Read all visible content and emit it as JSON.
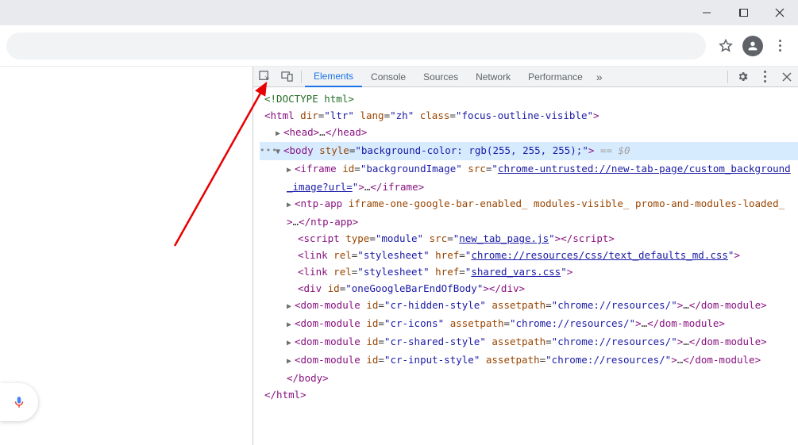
{
  "tabs": {
    "elements": "Elements",
    "console": "Console",
    "sources": "Sources",
    "network": "Network",
    "performance": "Performance"
  },
  "dom": {
    "doctype": "<!DOCTYPE html>",
    "html_open": {
      "dir": "ltr",
      "lang": "zh",
      "class": "focus-outline-visible"
    },
    "head": "head",
    "body_style": "background-color: rgb(255, 255, 255);",
    "eq_sel": " == $0",
    "iframe": {
      "id": "backgroundImage",
      "src": "chrome-untrusted://new-tab-page/custom_background_image?url="
    },
    "ntp_app_attrs": "iframe-one-google-bar-enabled_ modules-visible_ promo-and-modules-loaded_",
    "script": {
      "type": "module",
      "src": "new_tab_page.js"
    },
    "link1": {
      "rel": "stylesheet",
      "href": "chrome://resources/css/text_defaults_md.css"
    },
    "link2": {
      "rel": "stylesheet",
      "href": "shared_vars.css"
    },
    "div_id": "oneGoogleBarEndOfBody",
    "dm1": {
      "id": "cr-hidden-style",
      "assetpath": "chrome://resources/"
    },
    "dm2": {
      "id": "cr-icons",
      "assetpath": "chrome://resources/"
    },
    "dm3": {
      "id": "cr-shared-style",
      "assetpath": "chrome://resources/"
    },
    "dm4": {
      "id": "cr-input-style",
      "assetpath": "chrome://resources/"
    },
    "close_body": "</body>",
    "close_html": "</html>"
  }
}
